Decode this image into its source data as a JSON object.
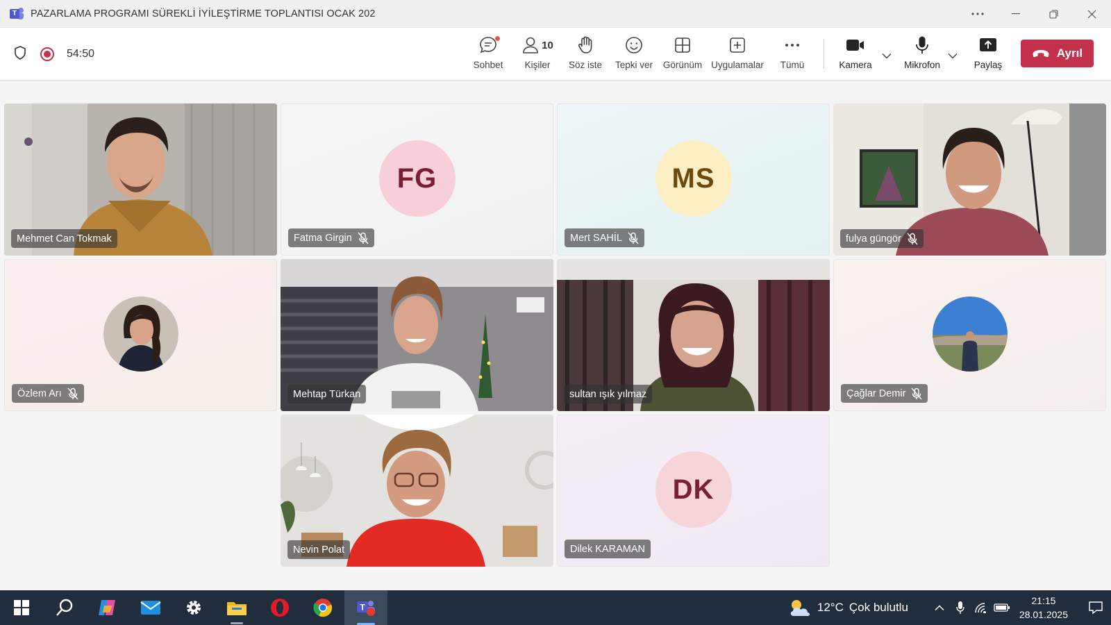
{
  "window": {
    "title": "PAZARLAMA PROGRAMI SÜREKLİ İYİLEŞTİRME TOPLANTISI OCAK 202",
    "app_icon": "teams-icon",
    "controls": [
      "more-icon",
      "minimize-icon",
      "restore-icon",
      "close-icon"
    ]
  },
  "toolbar": {
    "timer": "54:50",
    "chat_label": "Sohbet",
    "people_label": "Kişiler",
    "people_count": "10",
    "raise_hand_label": "Söz iste",
    "react_label": "Tepki ver",
    "view_label": "Görünüm",
    "apps_label": "Uygulamalar",
    "more_label": "Tümü",
    "camera_label": "Kamera",
    "mic_label": "Mikrofon",
    "share_label": "Paylaş",
    "leave_label": "Ayrıl",
    "leave_color": "#c4314b"
  },
  "participants": [
    {
      "name": "Mehmet Can Tokmak",
      "type": "video",
      "muted": false
    },
    {
      "name": "Fatma Girgin",
      "type": "initials",
      "initials": "FG",
      "avatar_bg": "#f6cfd8",
      "avatar_fg": "#7a1f33",
      "muted": true
    },
    {
      "name": "Mert SAHİL",
      "type": "initials",
      "initials": "MS",
      "avatar_bg": "#fdefc4",
      "avatar_fg": "#6b4a0c",
      "muted": true
    },
    {
      "name": "fulya güngör",
      "type": "video",
      "muted": true
    },
    {
      "name": "Özlem Arı",
      "type": "photo-avatar",
      "muted": true
    },
    {
      "name": "Mehtap Türkan",
      "type": "video",
      "muted": false
    },
    {
      "name": "sultan ışık yılmaz",
      "type": "video",
      "muted": false
    },
    {
      "name": "Çağlar Demir",
      "type": "photo-avatar",
      "muted": true
    },
    {
      "name": "Nevin Polat",
      "type": "video",
      "muted": false
    },
    {
      "name": "Dilek KARAMAN",
      "type": "initials",
      "initials": "DK",
      "avatar_bg": "#f6d5d8",
      "avatar_fg": "#7a1f33",
      "muted": false
    }
  ],
  "taskbar": {
    "apps": [
      "windows-start-icon",
      "search-icon",
      "copilot-icon",
      "mail-icon",
      "settings-icon",
      "file-explorer-icon",
      "opera-icon",
      "chrome-icon",
      "teams-icon"
    ],
    "weather_temp": "12°C",
    "weather_desc": "Çok bulutlu",
    "time": "21:15",
    "date": "28.01.2025"
  }
}
